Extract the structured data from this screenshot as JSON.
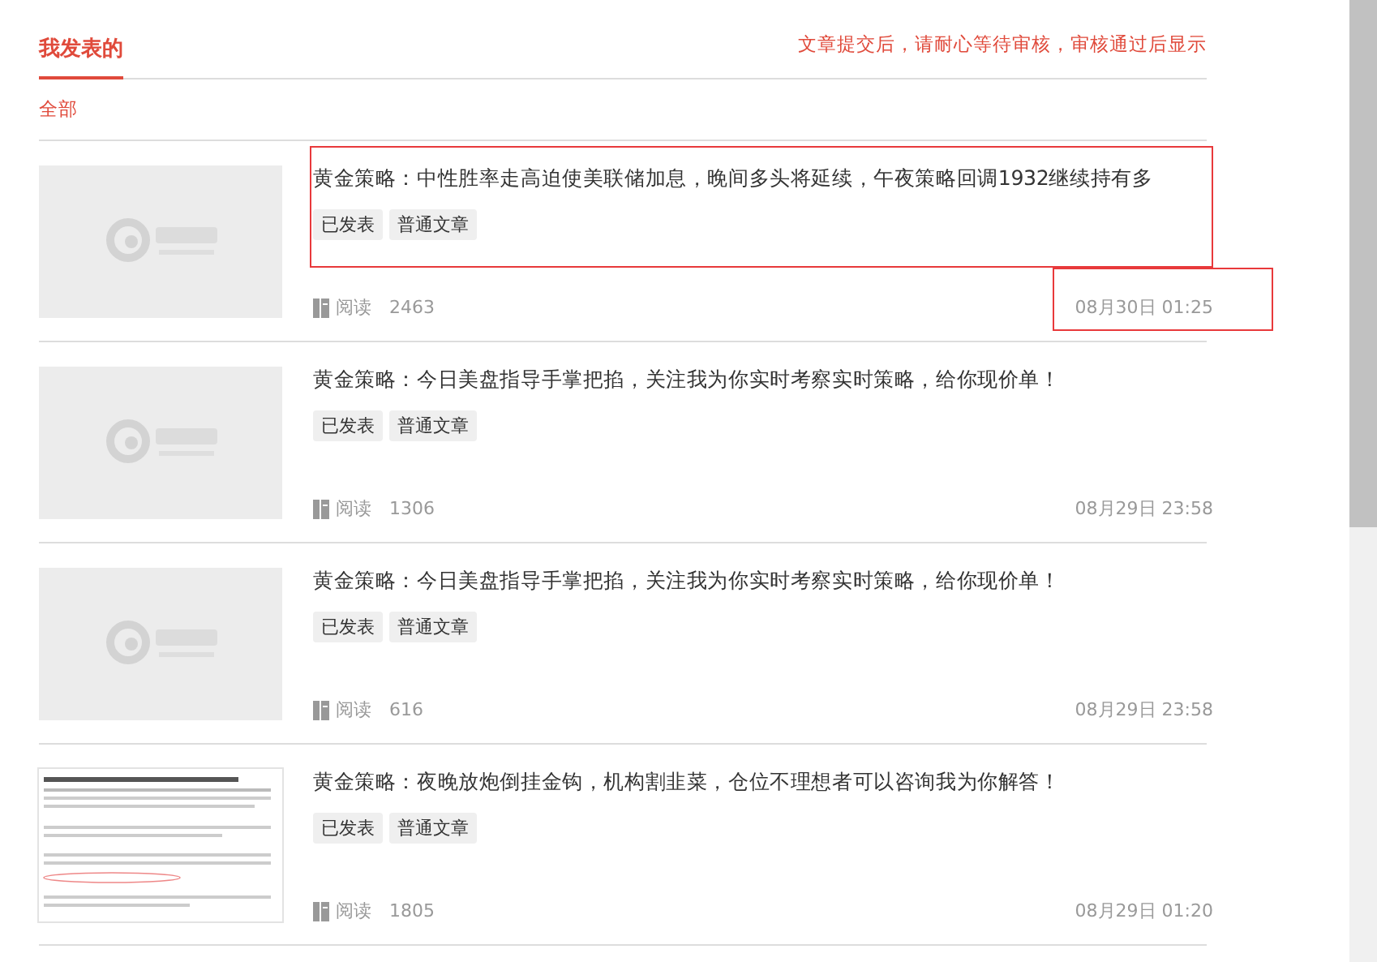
{
  "header": {
    "tabs": [
      {
        "label": "我发表的",
        "selected": true
      }
    ],
    "notice": "文章提交后，请耐心等待审核，审核通过后显示"
  },
  "filters": [
    {
      "label": "全部",
      "selected": true
    }
  ],
  "articles": [
    {
      "thumbnail": {
        "kind": "placeholder"
      },
      "title": "黄金策略：中性胜率走高迫使美联储加息，晚间多头将延续，午夜策略回调1932继续持有多",
      "tags": [
        "已发表",
        "普通文章"
      ],
      "read_label": "阅读",
      "reads": "2463",
      "date": "08月30日 01:25",
      "title_highlighted": true,
      "date_highlighted": true
    },
    {
      "thumbnail": {
        "kind": "placeholder"
      },
      "title": "黄金策略：今日美盘指导手掌把掐，关注我为你实时考察实时策略，给你现价单！",
      "tags": [
        "已发表",
        "普通文章"
      ],
      "read_label": "阅读",
      "reads": "1306",
      "date": "08月29日 23:58",
      "title_highlighted": false,
      "date_highlighted": false
    },
    {
      "thumbnail": {
        "kind": "placeholder"
      },
      "title": "黄金策略：今日美盘指导手掌把掐，关注我为你实时考察实时策略，给你现价单！",
      "tags": [
        "已发表",
        "普通文章"
      ],
      "read_label": "阅读",
      "reads": "616",
      "date": "08月29日 23:58",
      "title_highlighted": false,
      "date_highlighted": false
    },
    {
      "thumbnail": {
        "kind": "document"
      },
      "title": "黄金策略：夜晚放炮倒挂金钩，机构割韭菜，仓位不理想者可以咨询我为你解答！",
      "tags": [
        "已发表",
        "普通文章"
      ],
      "read_label": "阅读",
      "reads": "1805",
      "date": "08月29日 01:20",
      "title_highlighted": false,
      "date_highlighted": false
    }
  ]
}
